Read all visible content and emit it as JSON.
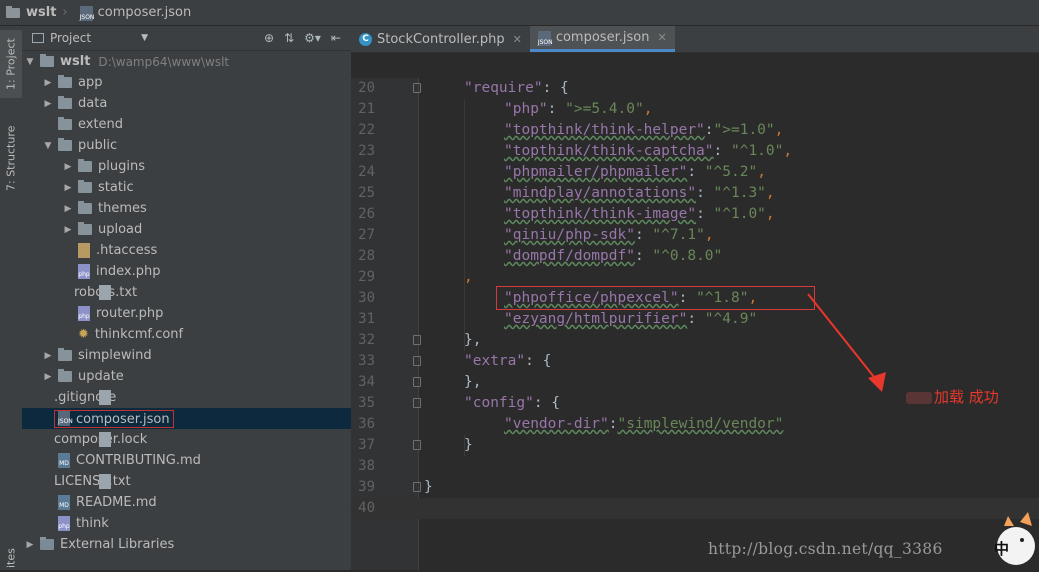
{
  "breadcrumb": {
    "project": "wslt",
    "file": "composer.json"
  },
  "toolstrip": {
    "project_tab": "1: Project",
    "structure_tab": "7: Structure",
    "favorites_tab": "ites"
  },
  "project_panel": {
    "title": "Project"
  },
  "tree": {
    "root": {
      "name": "wslt",
      "path": "D:\\wamp64\\www\\wslt"
    },
    "items": [
      {
        "label": "app"
      },
      {
        "label": "data"
      },
      {
        "label": "extend"
      },
      {
        "label": "public"
      },
      {
        "label": "plugins"
      },
      {
        "label": "static"
      },
      {
        "label": "themes"
      },
      {
        "label": "upload"
      },
      {
        "label": ".htaccess"
      },
      {
        "label": "index.php"
      },
      {
        "label": "robots.txt"
      },
      {
        "label": "router.php"
      },
      {
        "label": "thinkcmf.conf"
      },
      {
        "label": "simplewind"
      },
      {
        "label": "update"
      },
      {
        "label": ".gitignore"
      },
      {
        "label": "composer.json"
      },
      {
        "label": "composer.lock"
      },
      {
        "label": "CONTRIBUTING.md"
      },
      {
        "label": "LICENSE.txt"
      },
      {
        "label": "README.md"
      },
      {
        "label": "think"
      },
      {
        "label": "External Libraries"
      }
    ]
  },
  "tabs": [
    {
      "label": "StockController.php"
    },
    {
      "label": "composer.json"
    }
  ],
  "code": {
    "lines": [
      {
        "n": "20",
        "key": "\"require\"",
        "rest": ": {"
      },
      {
        "n": "21",
        "key": "\"php\"",
        "rest": ": ",
        "val": "\">=5.4.0\"",
        "end": ","
      },
      {
        "n": "22",
        "key": "\"topthink/think-helper\"",
        "rest": ":",
        "val": "\">=1.0\"",
        "end": ","
      },
      {
        "n": "23",
        "key": "\"topthink/think-captcha\"",
        "rest": ": ",
        "val": "\"^1.0\"",
        "end": ","
      },
      {
        "n": "24",
        "key": "\"phpmailer/phpmailer\"",
        "rest": ": ",
        "val": "\"^5.2\"",
        "end": ","
      },
      {
        "n": "25",
        "key": "\"mindplay/annotations\"",
        "rest": ": ",
        "val": "\"^1.3\"",
        "end": ","
      },
      {
        "n": "26",
        "key": "\"topthink/think-image\"",
        "rest": ": ",
        "val": "\"^1.0\"",
        "end": ","
      },
      {
        "n": "27",
        "key": "\"qiniu/php-sdk\"",
        "rest": ": ",
        "val": "\"^7.1\"",
        "end": ","
      },
      {
        "n": "28",
        "key": "\"dompdf/dompdf\"",
        "rest": ": ",
        "val": "\"^0.8.0\"",
        "end": ""
      },
      {
        "n": "29",
        "key": "",
        "rest": ",",
        "val": "",
        "end": ""
      },
      {
        "n": "30",
        "key": "\"phpoffice/phpexcel\"",
        "rest": ": ",
        "val": "\"^1.8\"",
        "end": ","
      },
      {
        "n": "31",
        "key": "\"ezyang/htmlpurifier\"",
        "rest": ": ",
        "val": "\"^4.9\"",
        "end": ""
      },
      {
        "n": "32",
        "key": "",
        "rest": "},",
        "val": "",
        "end": ""
      },
      {
        "n": "33",
        "key": "\"extra\"",
        "rest": ": {"
      },
      {
        "n": "34",
        "key": "",
        "rest": "},",
        "val": "",
        "end": ""
      },
      {
        "n": "35",
        "key": "\"config\"",
        "rest": ": {"
      },
      {
        "n": "36",
        "key": "\"vendor-dir\"",
        "rest": ":",
        "val": "\"simplewind/vendor\"",
        "end": ""
      },
      {
        "n": "37",
        "key": "",
        "rest": "}",
        "val": "",
        "end": ""
      },
      {
        "n": "38",
        "key": "",
        "rest": "",
        "val": "",
        "end": ""
      },
      {
        "n": "39",
        "key": "",
        "rest": "}",
        "val": "",
        "end": ""
      },
      {
        "n": "40",
        "key": "",
        "rest": "",
        "val": "",
        "end": ""
      }
    ]
  },
  "annotation": {
    "text": "加载 成功"
  },
  "watermark": {
    "text": "http://blog.csdn.net/qq_3386"
  },
  "ime": {
    "text": "中"
  },
  "colors": {
    "keyword": "#9876aa",
    "string": "#6a8759",
    "punct": "#cc7832",
    "annotation": "#e8372c",
    "selection": "#0d293e"
  }
}
